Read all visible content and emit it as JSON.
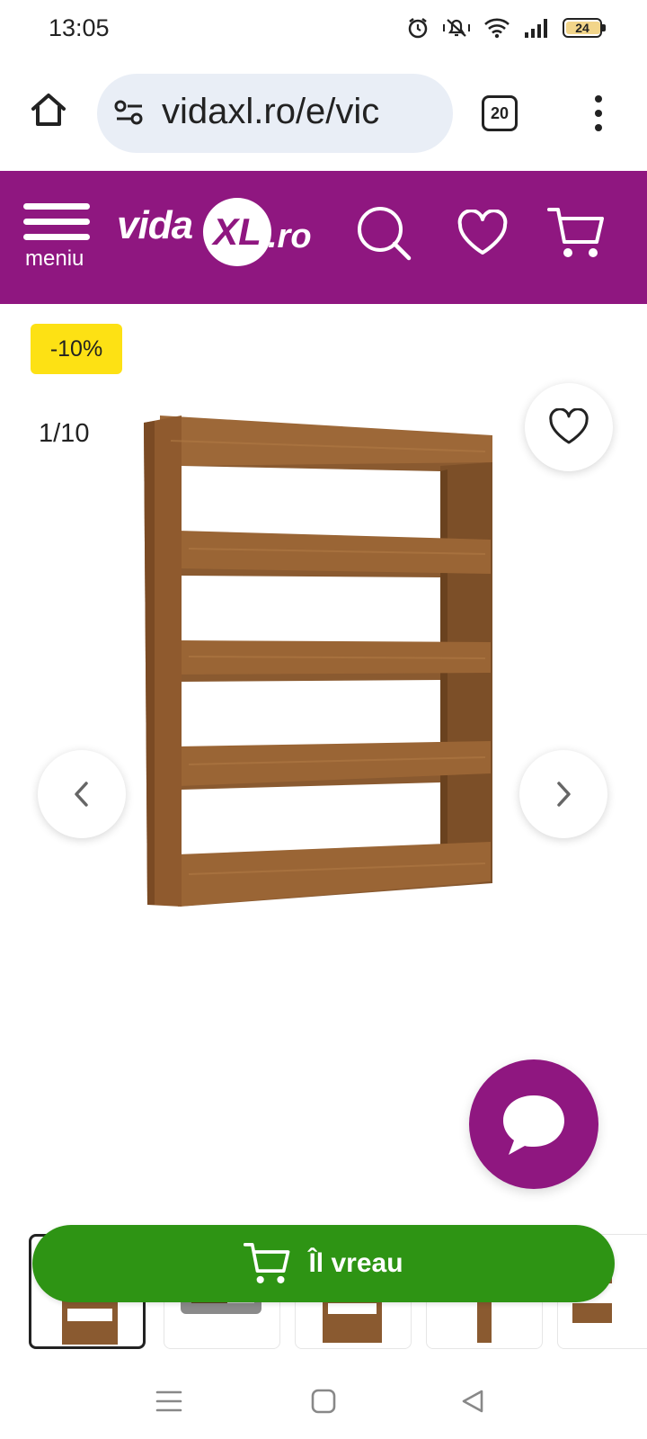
{
  "status_bar": {
    "time": "13:05",
    "battery_level": "24",
    "icons": [
      "alarm-icon",
      "silent-icon",
      "wifi-icon",
      "signal-icon",
      "battery-icon"
    ]
  },
  "browser": {
    "url": "vidaxl.ro/e/vic",
    "tab_count": "20",
    "icons": [
      "home-icon",
      "site-settings-icon",
      "tabs-icon",
      "more-vert-icon"
    ]
  },
  "header": {
    "menu_label": "meniu",
    "logo": {
      "part1": "vida",
      "part2": "XL",
      "part3": ".ro"
    },
    "brand_color": "#8f1780",
    "icons": [
      "search-icon",
      "heart-icon",
      "cart-icon"
    ]
  },
  "product": {
    "discount": "-10%",
    "image_counter": "1/10",
    "image_index": 1,
    "image_total": 10,
    "image_subject": "bookshelf"
  },
  "thumbnails": {
    "count_visible": 5,
    "active_index": 0
  },
  "cta": {
    "label": "Îl vreau",
    "color": "#2e9414",
    "icon": "cart-icon"
  },
  "android_nav": {
    "icons": [
      "recent-apps-icon",
      "home-square-icon",
      "back-triangle-icon"
    ]
  }
}
